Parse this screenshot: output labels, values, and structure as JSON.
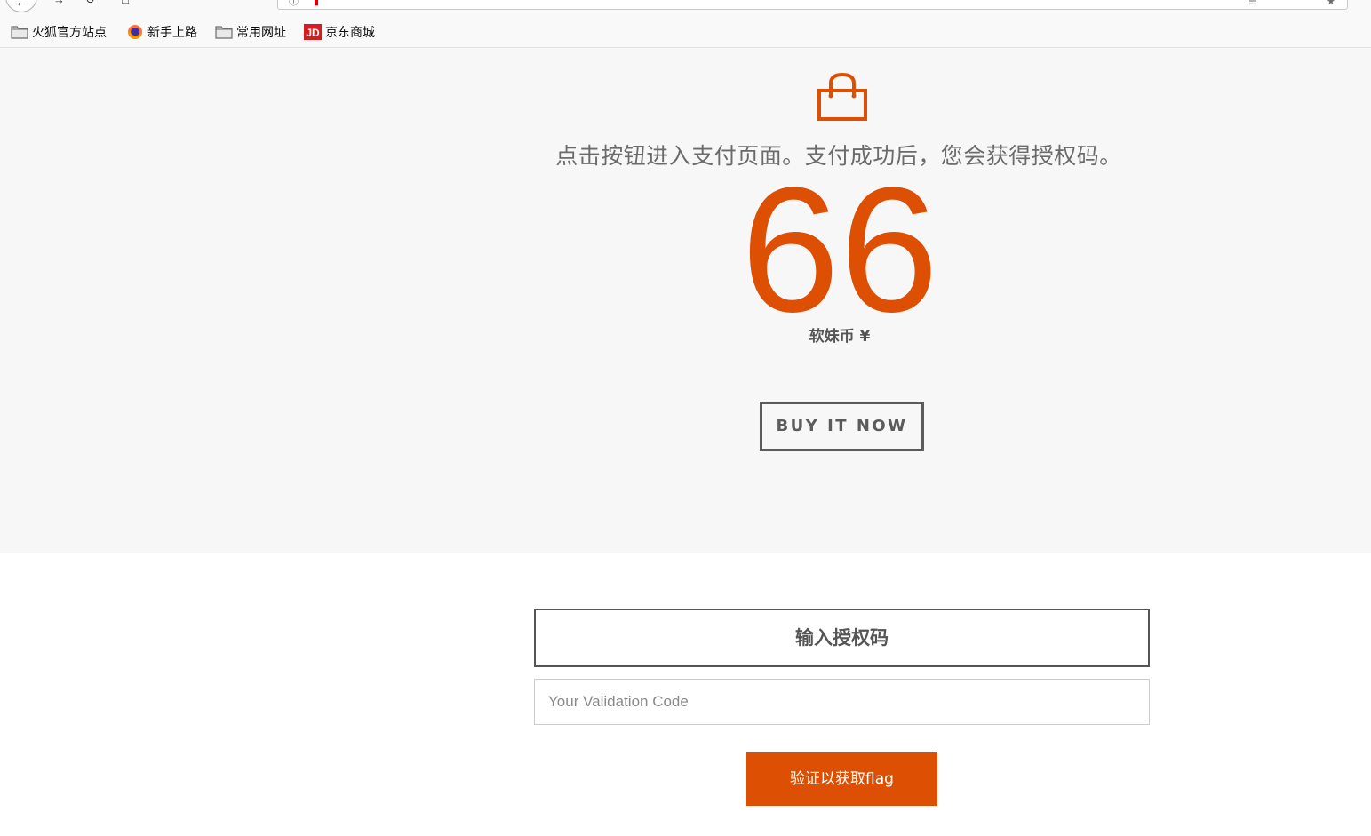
{
  "browser": {
    "bookmarks": [
      {
        "label": "火狐官方站点",
        "icon": "folder-icon"
      },
      {
        "label": "新手上路",
        "icon": "firefox-icon"
      },
      {
        "label": "常用网址",
        "icon": "folder-icon"
      },
      {
        "label": "京东商城",
        "icon": "jd-icon"
      }
    ],
    "jd_icon_text": "JD"
  },
  "hero": {
    "bag_icon": "shopping-bag-icon",
    "description": "点击按钮进入支付页面。支付成功后，您会获得授权码。",
    "price": "66",
    "currency": "软妹币 ¥",
    "buy_label": "BUY IT NOW"
  },
  "validation": {
    "heading": "输入授权码",
    "placeholder": "Your Validation Code",
    "value": "",
    "submit_label": "验证以获取flag"
  },
  "colors": {
    "accent": "#dd4f03",
    "hero_bg": "#f7f7f7",
    "text_gray": "#555555"
  }
}
